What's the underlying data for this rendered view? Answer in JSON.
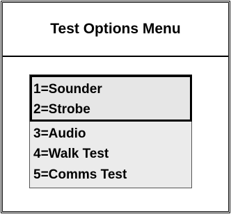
{
  "menu": {
    "title": "Test Options Menu",
    "items": [
      {
        "label": "1=Sounder",
        "selected": true
      },
      {
        "label": "2=Strobe",
        "selected": true
      },
      {
        "label": "3=Audio",
        "selected": false
      },
      {
        "label": "4=Walk Test",
        "selected": false
      },
      {
        "label": "5=Comms Test",
        "selected": false
      }
    ]
  },
  "colors": {
    "background": "#ffffff",
    "list_background": "#ebebeb",
    "border": "#000000",
    "text": "#000000"
  }
}
